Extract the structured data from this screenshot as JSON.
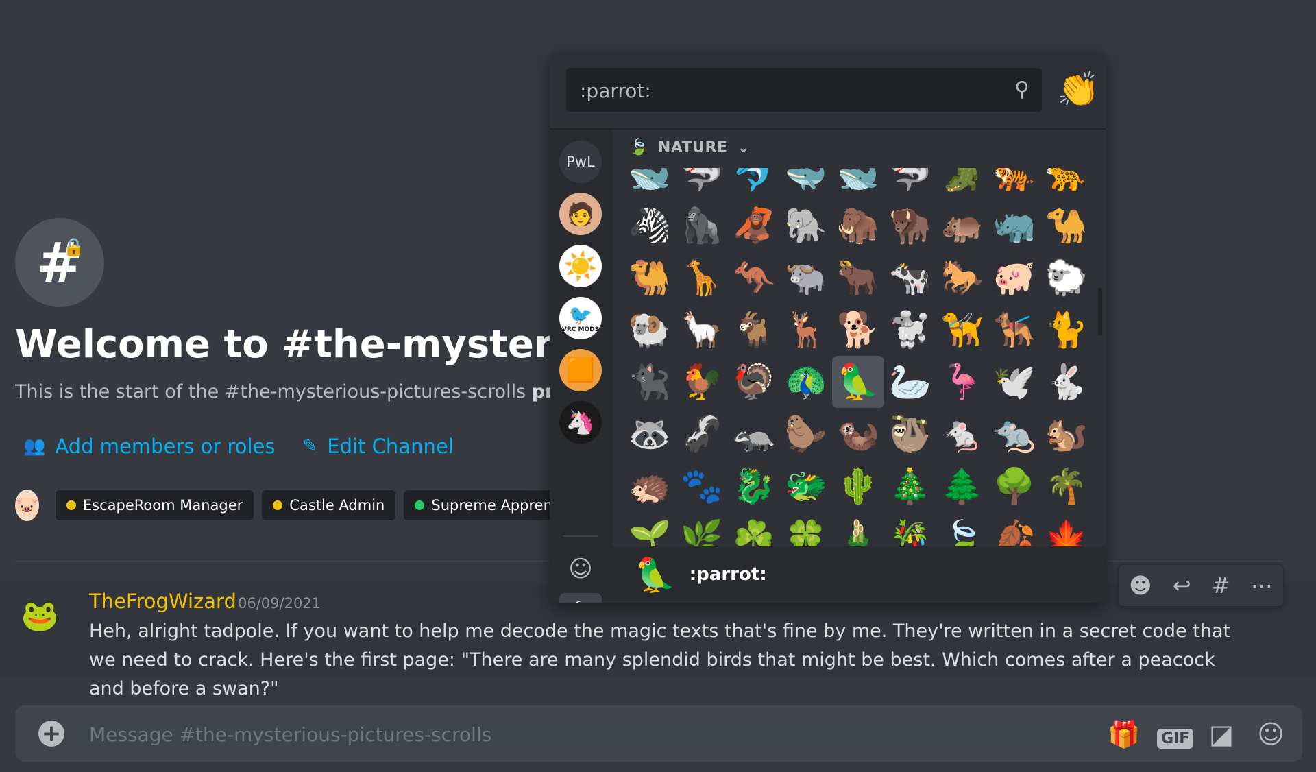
{
  "welcome": {
    "title": "Welcome to #the-mysterious-pictures-scrolls!",
    "subtitle_prefix": "This is the start of the #the-mysterious-pictures-scrolls ",
    "subtitle_bold": "private channel."
  },
  "actions": {
    "add_members": "Add members or roles",
    "edit_channel": "Edit Channel"
  },
  "roles": [
    {
      "name": "EscapeRoom Manager",
      "color": "#f1c40f"
    },
    {
      "name": "Castle Admin",
      "color": "#f1c40f"
    },
    {
      "name": "Supreme Apprentice",
      "color": "#2ecc71"
    }
  ],
  "message": {
    "author": "TheFrogWizard",
    "author_color": "#f0c000",
    "timestamp": "06/09/2021",
    "text": "Heh, alright tadpole. If you want to help me decode the magic texts that's fine by me. They're written in a secret code that we need to crack. Here's the first page: \"There are many splendid birds that might be best. Which comes after a peacock and before a swan?\""
  },
  "composer": {
    "placeholder": "Message #the-mysterious-pictures-scrolls",
    "gif_label": "GIF"
  },
  "emoji_picker": {
    "search_value": ":parrot:",
    "category": "NATURE",
    "guild_initials": "PwL",
    "guild_badge": "VRC MODS",
    "preview_emoji": "🦜",
    "preview_name": ":parrot:",
    "grid": [
      "🐋",
      "🦈",
      "🐬",
      "🐳",
      "🐋",
      "🦈",
      "🐊",
      "🐅",
      "🐆",
      "🦓",
      "🦍",
      "🦧",
      "🐘",
      "🦣",
      "🦬",
      "🦛",
      "🦏",
      "🐪",
      "🐫",
      "🦒",
      "🦘",
      "🐃",
      "🐂",
      "🐄",
      "🐎",
      "🐖",
      "🐑",
      "🐏",
      "🦙",
      "🐐",
      "🦌",
      "🐕",
      "🐩",
      "🦮",
      "🐕‍🦺",
      "🐈",
      "🐈‍⬛",
      "🐓",
      "🦃",
      "🦚",
      "🦜",
      "🦢",
      "🦩",
      "🕊️",
      "🐇",
      "🦝",
      "🦨",
      "🦡",
      "🦫",
      "🦦",
      "🦥",
      "🐁",
      "🐀",
      "🐿️",
      "🦔",
      "🐾",
      "🐉",
      "🐲",
      "🌵",
      "🎄",
      "🌲",
      "🌳",
      "🌴",
      "🌱",
      "🌿",
      "☘️",
      "🍀",
      "🎍",
      "🎋",
      "🍃",
      "🍂",
      "🍁"
    ]
  }
}
